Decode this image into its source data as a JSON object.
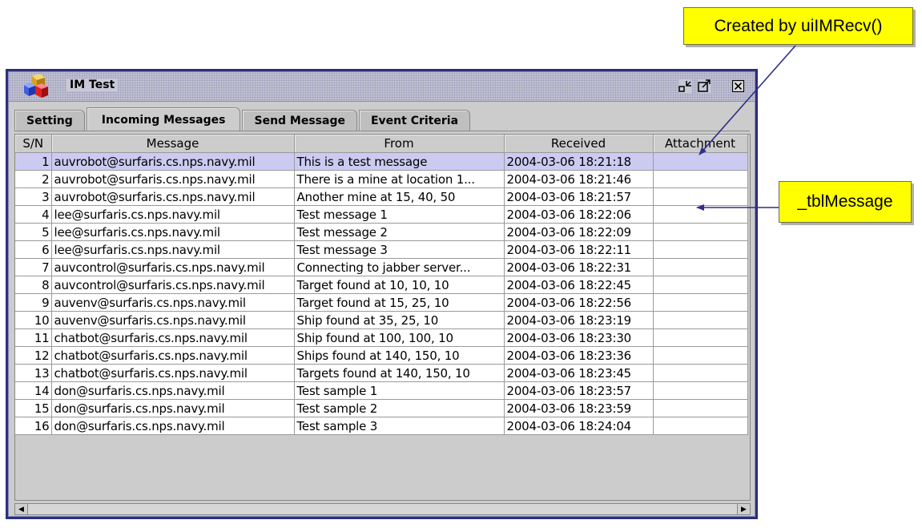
{
  "callouts": {
    "created_by": "Created by uiIMRecv()",
    "table_name": "_tblMessage"
  },
  "window": {
    "title": "IM Test"
  },
  "tabs": [
    {
      "label": "Setting",
      "active": false
    },
    {
      "label": "Incoming Messages",
      "active": true
    },
    {
      "label": "Send Message",
      "active": false
    },
    {
      "label": "Event Criteria",
      "active": false
    }
  ],
  "table": {
    "columns": [
      "S/N",
      "Message",
      "From",
      "Received",
      "Attachment"
    ],
    "rows": [
      {
        "sn": "1",
        "message": "auvrobot@surfaris.cs.nps.navy.mil",
        "from": "This is a test message",
        "received": "2004-03-06 18:21:18",
        "attachment": ""
      },
      {
        "sn": "2",
        "message": "auvrobot@surfaris.cs.nps.navy.mil",
        "from": "There is a mine at location 1...",
        "received": "2004-03-06 18:21:46",
        "attachment": ""
      },
      {
        "sn": "3",
        "message": "auvrobot@surfaris.cs.nps.navy.mil",
        "from": "Another mine at 15, 40, 50",
        "received": "2004-03-06 18:21:57",
        "attachment": ""
      },
      {
        "sn": "4",
        "message": "lee@surfaris.cs.nps.navy.mil",
        "from": "Test message 1",
        "received": "2004-03-06 18:22:06",
        "attachment": ""
      },
      {
        "sn": "5",
        "message": "lee@surfaris.cs.nps.navy.mil",
        "from": "Test message 2",
        "received": "2004-03-06 18:22:09",
        "attachment": ""
      },
      {
        "sn": "6",
        "message": "lee@surfaris.cs.nps.navy.mil",
        "from": "Test message 3",
        "received": "2004-03-06 18:22:11",
        "attachment": ""
      },
      {
        "sn": "7",
        "message": "auvcontrol@surfaris.cs.nps.navy.mil",
        "from": "Connecting to jabber server...",
        "received": "2004-03-06 18:22:31",
        "attachment": ""
      },
      {
        "sn": "8",
        "message": "auvcontrol@surfaris.cs.nps.navy.mil",
        "from": "Target found at 10, 10, 10",
        "received": "2004-03-06 18:22:45",
        "attachment": ""
      },
      {
        "sn": "9",
        "message": "auvenv@surfaris.cs.nps.navy.mil",
        "from": "Target found at 15, 25, 10",
        "received": "2004-03-06 18:22:56",
        "attachment": ""
      },
      {
        "sn": "10",
        "message": "auvenv@surfaris.cs.nps.navy.mil",
        "from": "Ship found at 35, 25, 10",
        "received": "2004-03-06 18:23:19",
        "attachment": ""
      },
      {
        "sn": "11",
        "message": "chatbot@surfaris.cs.nps.navy.mil",
        "from": "Ship found at 100, 100, 10",
        "received": "2004-03-06 18:23:30",
        "attachment": ""
      },
      {
        "sn": "12",
        "message": "chatbot@surfaris.cs.nps.navy.mil",
        "from": "Ships found at 140, 150, 10",
        "received": "2004-03-06 18:23:36",
        "attachment": ""
      },
      {
        "sn": "13",
        "message": "chatbot@surfaris.cs.nps.navy.mil",
        "from": "Targets found at 140, 150, 10",
        "received": "2004-03-06 18:23:45",
        "attachment": ""
      },
      {
        "sn": "14",
        "message": "don@surfaris.cs.nps.navy.mil",
        "from": "Test sample 1",
        "received": "2004-03-06 18:23:57",
        "attachment": ""
      },
      {
        "sn": "15",
        "message": "don@surfaris.cs.nps.navy.mil",
        "from": "Test sample 2",
        "received": "2004-03-06 18:23:59",
        "attachment": ""
      },
      {
        "sn": "16",
        "message": "don@surfaris.cs.nps.navy.mil",
        "from": "Test sample 3",
        "received": "2004-03-06 18:24:04",
        "attachment": ""
      }
    ],
    "selected_row": 1
  },
  "icons": {
    "app": "app-cubes-icon",
    "minimize": "minimize-icon",
    "maximize": "maximize-icon",
    "close": "close-icon",
    "scroll_left": "scroll-left-arrow-icon",
    "scroll_right": "scroll-right-arrow-icon"
  },
  "colors": {
    "callout": "#ffff00",
    "window_frame": "#2d2f7a",
    "selection": "#cbcbf2",
    "arrow": "#2d2f8a"
  }
}
